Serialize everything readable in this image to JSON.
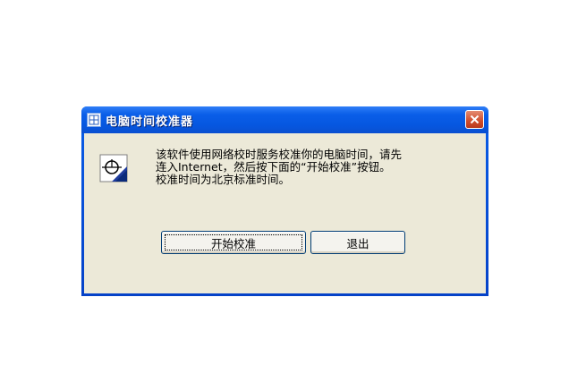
{
  "window": {
    "title": "电脑时间校准器",
    "close_symbol": "✕"
  },
  "dialog": {
    "icon": "clock-icon",
    "message": "该软件使用网络校时服务校准你的电脑时间，请先\n连入Internet，然后按下面的“开始校准”按钮。\n校准时间为北京标准时间。"
  },
  "buttons": {
    "start_label": "开始校准",
    "exit_label": "退出"
  },
  "colors": {
    "titlebar": "#0a5ee8",
    "client": "#ece9d8",
    "close": "#cf4c2b"
  }
}
